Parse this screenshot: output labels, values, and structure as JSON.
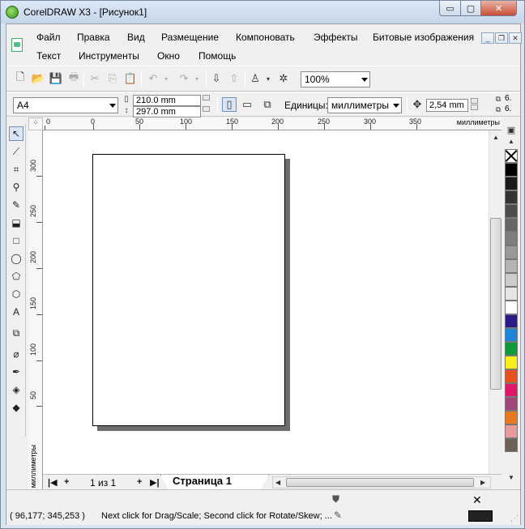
{
  "window": {
    "title": "CorelDRAW X3 - [Рисунок1]",
    "min_glyph": "▭",
    "max_glyph": "▢",
    "close_glyph": "✕"
  },
  "menu": {
    "row1": [
      "Файл",
      "Правка",
      "Вид",
      "Размещение",
      "Компоновать",
      "Эффекты",
      "Битовые изображения"
    ],
    "row2": [
      "Текст",
      "Инструменты",
      "Окно",
      "Помощь"
    ]
  },
  "standard_toolbar": {
    "zoom_value": "100%"
  },
  "property_bar": {
    "paper_size": "A4",
    "width": "210.0 mm",
    "height": "297.0 mm",
    "units_label": "Единицы:",
    "units_value": "миллиметры",
    "nudge": "2,54 mm",
    "dup_x": "6.",
    "dup_y": "6."
  },
  "rulers": {
    "unit": "миллиметры",
    "h_ticks": [
      "0",
      "0",
      "50",
      "100",
      "150",
      "200",
      "250",
      "300",
      "350"
    ],
    "v_ticks": [
      "300",
      "250",
      "200",
      "150",
      "100",
      "50"
    ]
  },
  "page_nav": {
    "count": "1 из 1",
    "tab_label": "Страница 1"
  },
  "palette": {
    "colors": [
      "#000000",
      "#1a1a1a",
      "#333333",
      "#4d4d4d",
      "#666666",
      "#7f7f7f",
      "#999999",
      "#b3b3b3",
      "#cccccc",
      "#e5e5e5",
      "#ffffff",
      "#2e1a87",
      "#1e86d8",
      "#0f9a3a",
      "#f6ef1d",
      "#e8521e",
      "#e0176b",
      "#a0447a",
      "#e8791f",
      "#e89a9c",
      "#6e6055"
    ]
  },
  "status": {
    "coords": "( 96,177; 345,253 )",
    "hint": "Next click for Drag/Scale; Second click for Rotate/Skew; ..."
  }
}
